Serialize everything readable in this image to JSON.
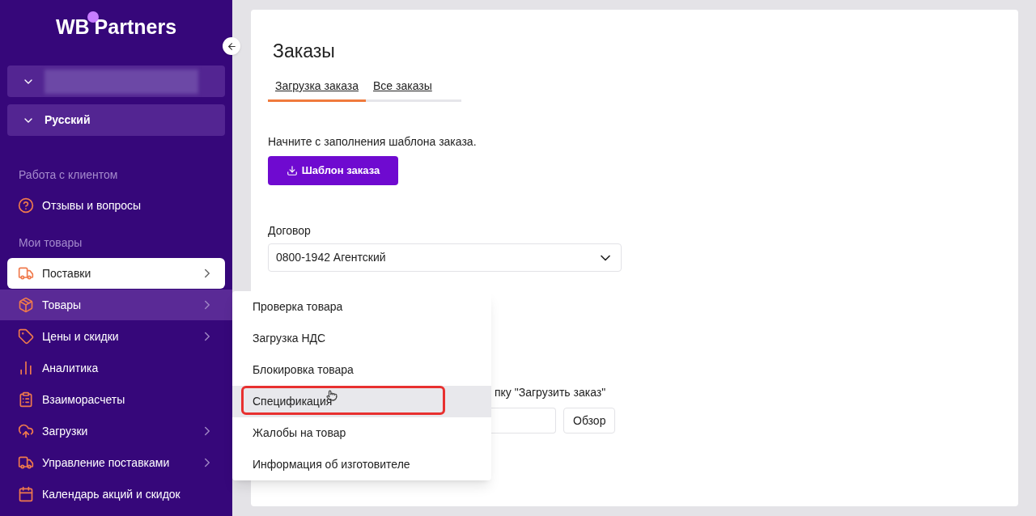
{
  "logo": {
    "part_1": "WB",
    "part_2": "Partners"
  },
  "language_selector": {
    "value": "Русский"
  },
  "sidebar": {
    "groups": [
      {
        "title": "Работа с клиентом",
        "items": [
          {
            "label": "Отзывы и вопросы",
            "kind": "link",
            "selected": false,
            "expanded": false
          }
        ]
      },
      {
        "title": "Мои товары",
        "items": [
          {
            "label": "Поставки",
            "kind": "submenu",
            "selected": true,
            "expanded": false
          },
          {
            "label": "Товары",
            "kind": "submenu",
            "selected": false,
            "expanded": true
          },
          {
            "label": "Цены и скидки",
            "kind": "submenu",
            "selected": false,
            "expanded": false
          },
          {
            "label": "Аналитика",
            "kind": "link",
            "selected": false,
            "expanded": false
          },
          {
            "label": "Взаиморасчеты",
            "kind": "link",
            "selected": false,
            "expanded": false
          },
          {
            "label": "Загрузки",
            "kind": "submenu",
            "selected": false,
            "expanded": false
          },
          {
            "label": "Управление поставками",
            "kind": "submenu",
            "selected": false,
            "expanded": false
          },
          {
            "label": "Календарь акций и скидок",
            "kind": "link",
            "selected": false,
            "expanded": false
          }
        ]
      }
    ]
  },
  "submenu": {
    "items": [
      {
        "label": "Проверка товара",
        "selected": false,
        "outlined": false
      },
      {
        "label": "Загрузка НДС",
        "selected": false,
        "outlined": false
      },
      {
        "label": "Блокировка товара",
        "selected": false,
        "outlined": false
      },
      {
        "label": "Спецификация",
        "selected": true,
        "outlined": true
      },
      {
        "label": "Жалобы на товар",
        "selected": false,
        "outlined": false
      },
      {
        "label": "Информация об изготовителе",
        "selected": false,
        "outlined": false
      }
    ]
  },
  "page": {
    "title": "Заказы",
    "tabs": [
      {
        "label": "Загрузка заказа",
        "selected": true
      },
      {
        "label": "Все заказы",
        "selected": false
      }
    ],
    "hint": "Начните с заполнения шаблона заказа.",
    "template_button": "Шаблон заказа",
    "contract": {
      "label": "Договор",
      "value": "0800-1942 Агентский"
    },
    "upload": {
      "instruction": "пку \"Загрузить заказ\"",
      "browse_button": "Обзор"
    }
  }
}
